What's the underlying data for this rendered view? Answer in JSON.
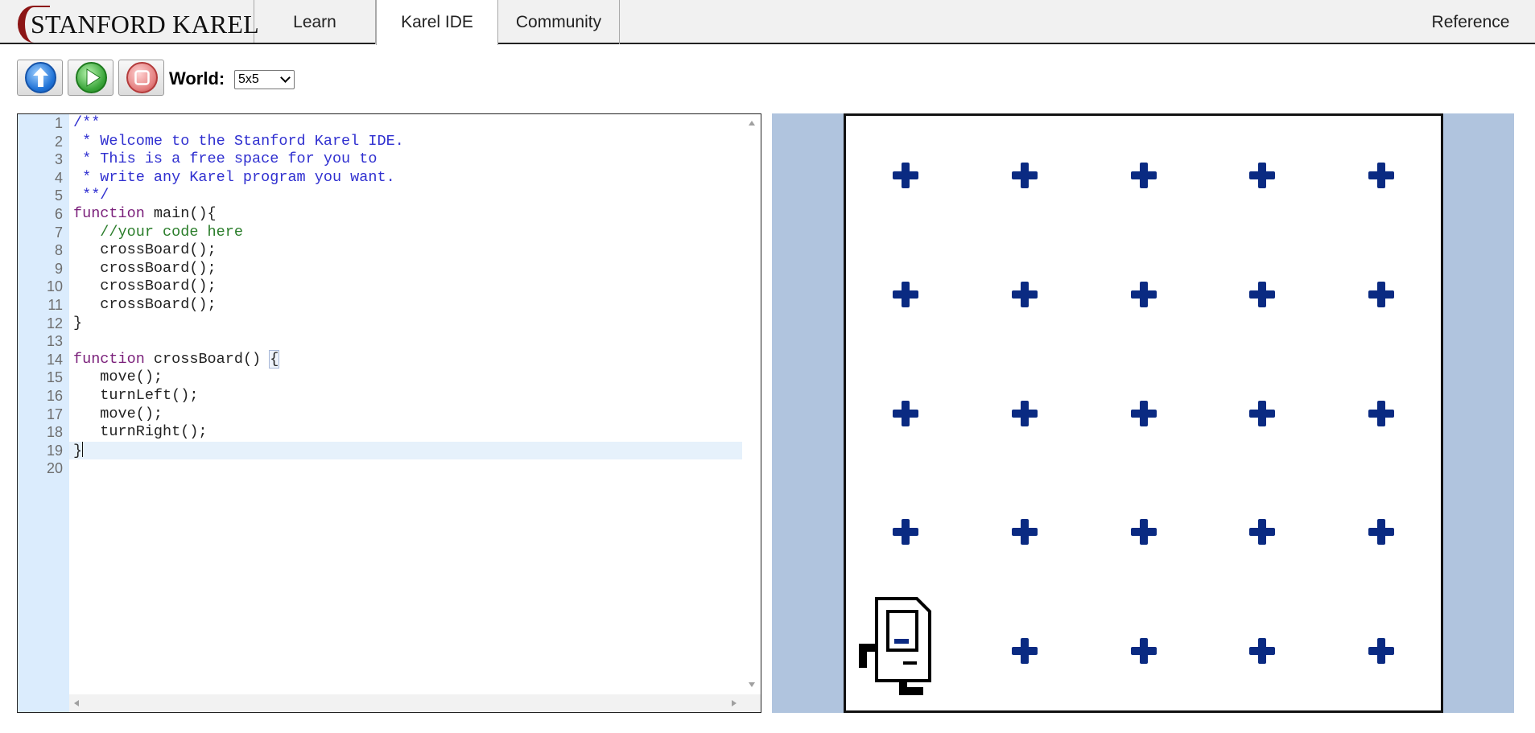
{
  "nav": {
    "logo_text": "STANFORD KAREL",
    "tabs": [
      {
        "label": "Learn",
        "active": false
      },
      {
        "label": "Karel IDE",
        "active": true
      },
      {
        "label": "Community",
        "active": false
      }
    ],
    "reference_label": "Reference"
  },
  "toolbar": {
    "buttons": [
      {
        "name": "upload",
        "icon": "up-arrow-icon",
        "color": "#1f72d6"
      },
      {
        "name": "run",
        "icon": "play-icon",
        "color": "#3aa53a"
      },
      {
        "name": "stop",
        "icon": "stop-icon",
        "color": "#e47f7f"
      }
    ],
    "world_label": "World:",
    "world_selected": "5x5"
  },
  "editor": {
    "lines": [
      {
        "num": "1",
        "text": "/**",
        "kind": "comment"
      },
      {
        "num": "2",
        "text": " * Welcome to the Stanford Karel IDE.",
        "kind": "comment"
      },
      {
        "num": "3",
        "text": " * This is a free space for you to",
        "kind": "comment"
      },
      {
        "num": "4",
        "text": " * write any Karel program you want.",
        "kind": "comment"
      },
      {
        "num": "5",
        "text": " **/",
        "kind": "comment"
      },
      {
        "num": "6",
        "kw": "function",
        "text": " main(){",
        "kind": "code"
      },
      {
        "num": "7",
        "text": "   //your code here",
        "kind": "linecomment"
      },
      {
        "num": "8",
        "text": "   crossBoard();",
        "kind": "plain"
      },
      {
        "num": "9",
        "text": "   crossBoard();",
        "kind": "plain"
      },
      {
        "num": "10",
        "text": "   crossBoard();",
        "kind": "plain"
      },
      {
        "num": "11",
        "text": "   crossBoard();",
        "kind": "plain"
      },
      {
        "num": "12",
        "text": "}",
        "kind": "plain"
      },
      {
        "num": "13",
        "text": "",
        "kind": "plain"
      },
      {
        "num": "14",
        "kw": "function",
        "text": " crossBoard() ",
        "brace": "{",
        "kind": "code"
      },
      {
        "num": "15",
        "text": "   move();",
        "kind": "plain"
      },
      {
        "num": "16",
        "text": "   turnLeft();",
        "kind": "plain"
      },
      {
        "num": "17",
        "text": "   move();",
        "kind": "plain"
      },
      {
        "num": "18",
        "text": "   turnRight();",
        "kind": "plain"
      },
      {
        "num": "19",
        "text": "}",
        "kind": "cursorline"
      },
      {
        "num": "20",
        "text": "",
        "kind": "plain"
      }
    ]
  },
  "world": {
    "rows": 5,
    "cols": 5,
    "karel": {
      "row": 1,
      "col": 1,
      "facing": "east"
    },
    "beeper_color": "#0a2a82",
    "background_color": "#b0c4de"
  }
}
